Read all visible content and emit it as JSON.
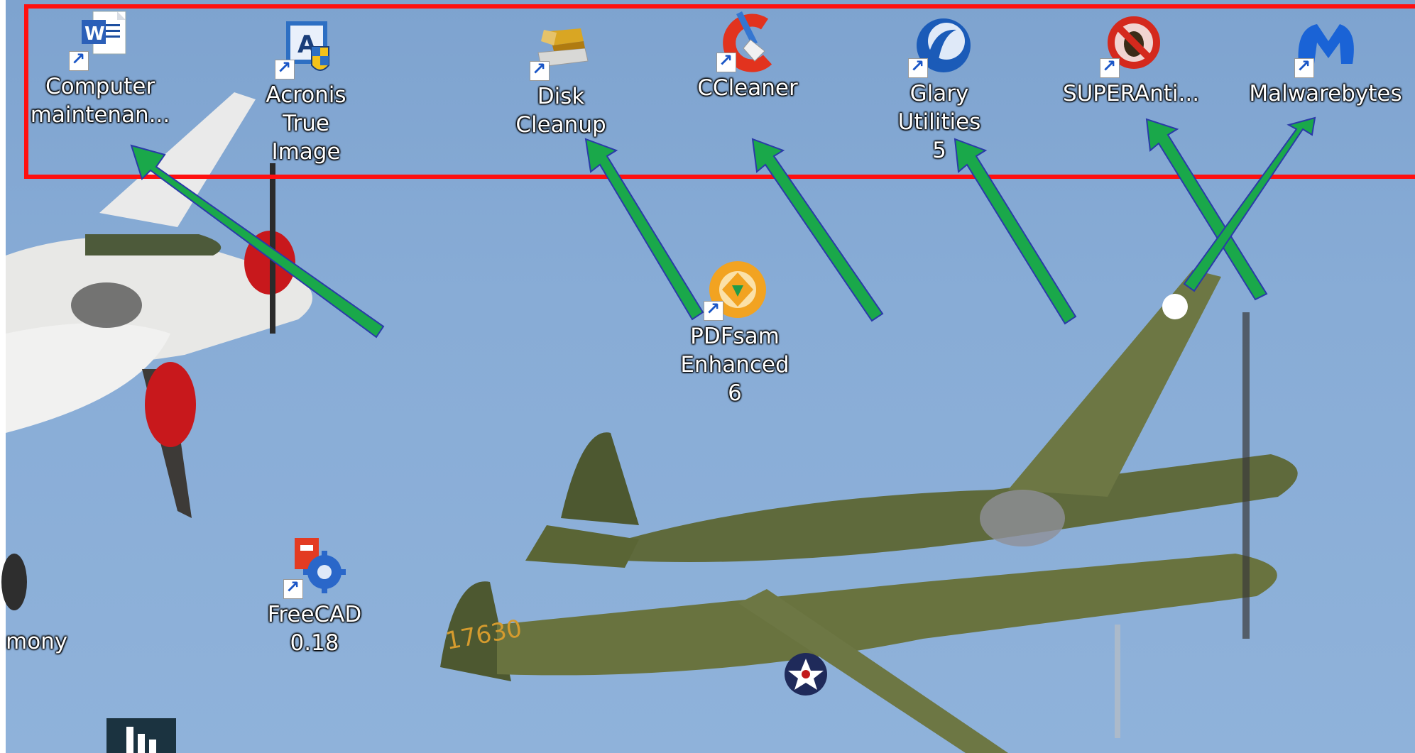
{
  "desktop": {
    "icons": [
      {
        "label": "Computer\nmaintenan...",
        "icon": "word-document-icon"
      },
      {
        "label": "Acronis True\nImage",
        "icon": "acronis-icon"
      },
      {
        "label": "Disk Cleanup",
        "icon": "disk-cleanup-icon"
      },
      {
        "label": "CCleaner",
        "icon": "ccleaner-icon"
      },
      {
        "label": "Glary Utilities\n5",
        "icon": "glary-utilities-icon"
      },
      {
        "label": "SUPERAnti...",
        "icon": "superantispyware-icon"
      },
      {
        "label": "Malwarebytes",
        "icon": "malwarebytes-icon"
      },
      {
        "label": "PDFsam\nEnhanced 6",
        "icon": "pdfsam-icon"
      },
      {
        "label": "FreeCAD 0.18",
        "icon": "freecad-icon"
      }
    ],
    "partial_label": "mony",
    "plane_tail_number": "17630"
  },
  "colors": {
    "highlight_border": "#ff1010",
    "arrow_fill": "#1aa84a",
    "arrow_outline": "#2a3aa8",
    "sky": "#86aad4"
  }
}
